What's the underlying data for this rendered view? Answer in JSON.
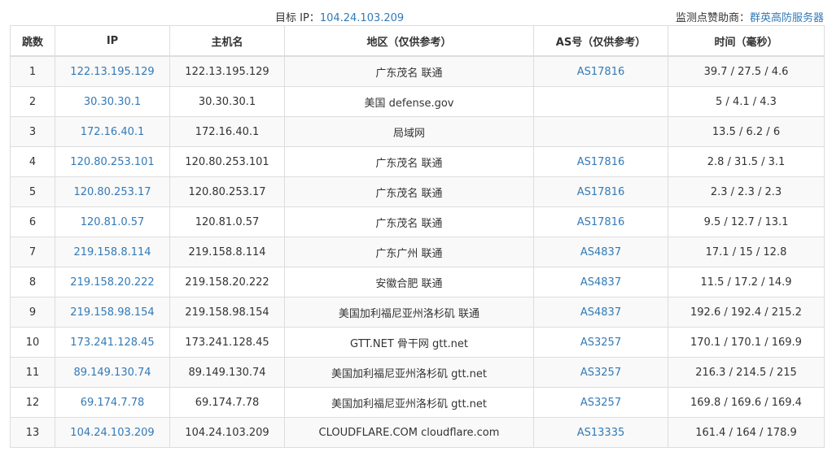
{
  "header": {
    "target_label": "目标 IP：",
    "target_ip": "104.24.103.209",
    "sponsor_label": "监测点赞助商：",
    "sponsor_name": "群英高防服务器"
  },
  "table": {
    "columns": [
      "跳数",
      "IP",
      "主机名",
      "地区（仅供参考）",
      "AS号（仅供参考）",
      "时间（毫秒）"
    ],
    "rows": [
      {
        "hop": "1",
        "ip": "122.13.195.129",
        "host": "122.13.195.129",
        "region": "广东茂名 联通",
        "as": "AS17816",
        "time": "39.7 / 27.5 / 4.6"
      },
      {
        "hop": "2",
        "ip": "30.30.30.1",
        "host": "30.30.30.1",
        "region": "美国 defense.gov",
        "as": "",
        "time": "5 / 4.1 / 4.3"
      },
      {
        "hop": "3",
        "ip": "172.16.40.1",
        "host": "172.16.40.1",
        "region": "局域网",
        "as": "",
        "time": "13.5 / 6.2 / 6"
      },
      {
        "hop": "4",
        "ip": "120.80.253.101",
        "host": "120.80.253.101",
        "region": "广东茂名 联通",
        "as": "AS17816",
        "time": "2.8 / 31.5 / 3.1"
      },
      {
        "hop": "5",
        "ip": "120.80.253.17",
        "host": "120.80.253.17",
        "region": "广东茂名 联通",
        "as": "AS17816",
        "time": "2.3 / 2.3 / 2.3"
      },
      {
        "hop": "6",
        "ip": "120.81.0.57",
        "host": "120.81.0.57",
        "region": "广东茂名 联通",
        "as": "AS17816",
        "time": "9.5 / 12.7 / 13.1"
      },
      {
        "hop": "7",
        "ip": "219.158.8.114",
        "host": "219.158.8.114",
        "region": "广东广州 联通",
        "as": "AS4837",
        "time": "17.1 / 15 / 12.8"
      },
      {
        "hop": "8",
        "ip": "219.158.20.222",
        "host": "219.158.20.222",
        "region": "安徽合肥 联通",
        "as": "AS4837",
        "time": "11.5 / 17.2 / 14.9"
      },
      {
        "hop": "9",
        "ip": "219.158.98.154",
        "host": "219.158.98.154",
        "region": "美国加利福尼亚州洛杉矶 联通",
        "as": "AS4837",
        "time": "192.6 / 192.4 / 215.2"
      },
      {
        "hop": "10",
        "ip": "173.241.128.45",
        "host": "173.241.128.45",
        "region": "GTT.NET 骨干网 gtt.net",
        "as": "AS3257",
        "time": "170.1 / 170.1 / 169.9"
      },
      {
        "hop": "11",
        "ip": "89.149.130.74",
        "host": "89.149.130.74",
        "region": "美国加利福尼亚州洛杉矶 gtt.net",
        "as": "AS3257",
        "time": "216.3 / 214.5 / 215"
      },
      {
        "hop": "12",
        "ip": "69.174.7.78",
        "host": "69.174.7.78",
        "region": "美国加利福尼亚州洛杉矶 gtt.net",
        "as": "AS3257",
        "time": "169.8 / 169.6 / 169.4"
      },
      {
        "hop": "13",
        "ip": "104.24.103.209",
        "host": "104.24.103.209",
        "region": "CLOUDFLARE.COM cloudflare.com",
        "as": "AS13335",
        "time": "161.4 / 164 / 178.9"
      }
    ]
  },
  "colors": {
    "link": "#337ab7",
    "text": "#333333",
    "stripe": "#f9f9f9",
    "border": "#dddddd"
  }
}
